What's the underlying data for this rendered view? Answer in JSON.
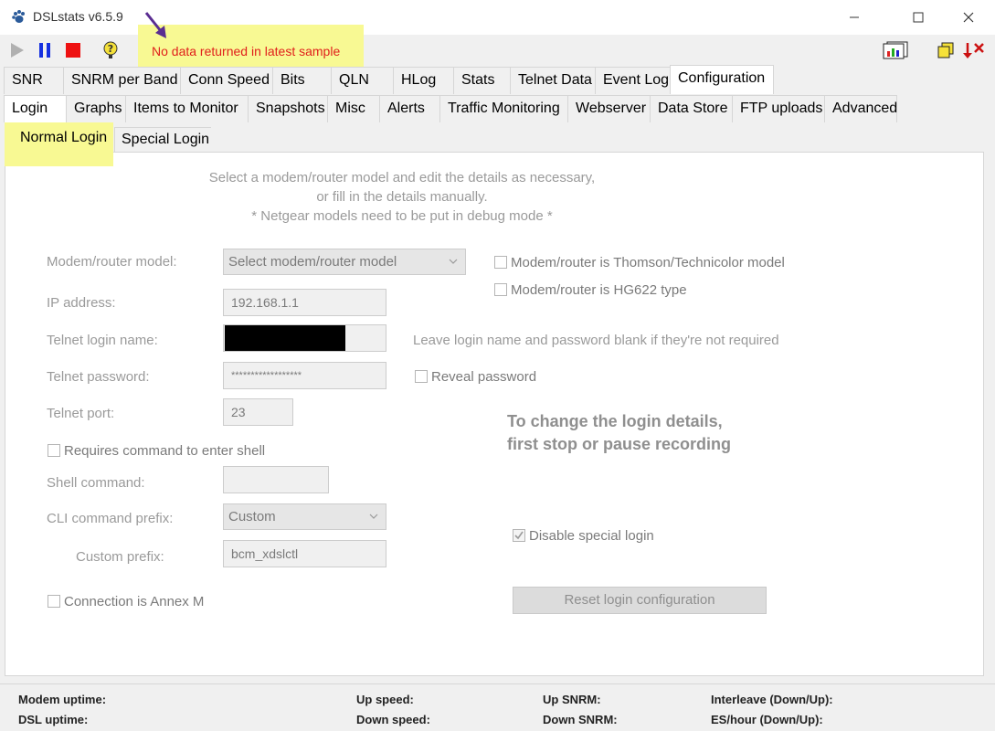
{
  "window": {
    "title": "DSLstats v6.5.9",
    "minimize_icon": "minimize-icon",
    "maximize_icon": "maximize-icon",
    "close_icon": "close-icon"
  },
  "toolbar": {
    "banner": "No data returned in latest sample",
    "banner_color": "#e0201c",
    "highlight_color": "#f8f993"
  },
  "tabs_main": [
    "SNR",
    "SNRM per Band",
    "Conn Speed",
    "Bits",
    "QLN",
    "HLog",
    "Stats",
    "Telnet Data",
    "Event Log",
    "Configuration"
  ],
  "tabs_config": [
    "Login",
    "Graphs",
    "Items to Monitor",
    "Snapshots",
    "Misc",
    "Alerts",
    "Traffic Monitoring",
    "Webserver",
    "Data Store",
    "FTP uploads",
    "Advanced"
  ],
  "tabs_login": [
    "Normal Login",
    "Special Login"
  ],
  "intro": {
    "line1": "Select a modem/router model and edit the details as necessary,",
    "line2": "or fill in the details manually.",
    "line3": "* Netgear models need to be put in debug mode *"
  },
  "form": {
    "model_label": "Modem/router model:",
    "model_value": "Select modem/router model",
    "ip_label": "IP address:",
    "ip_value": "192.168.1.1",
    "login_label": "Telnet login name:",
    "password_label": "Telnet password:",
    "password_value": "******************",
    "port_label": "Telnet port:",
    "port_value": "23",
    "requires_shell_label": "Requires command to enter shell",
    "shell_label": "Shell command:",
    "cli_label": "CLI command prefix:",
    "cli_value": "Custom",
    "custom_label": "Custom prefix:",
    "custom_value": "bcm_xdslctl",
    "annex_label": "Connection is Annex M",
    "thomson_label": "Modem/router is Thomson/Technicolor model",
    "hg622_label": "Modem/router is HG622 type",
    "blank_hint": "Leave login name and password blank if they're not required",
    "reveal_label": "Reveal password",
    "warn_line1": "To change the login details,",
    "warn_line2": "first stop or pause recording",
    "disable_special_label": "Disable special login",
    "reset_button": "Reset login configuration"
  },
  "status": {
    "modem_uptime": "Modem uptime:",
    "dsl_uptime": "DSL uptime:",
    "up_speed": "Up speed:",
    "down_speed": "Down speed:",
    "up_snrm": "Up SNRM:",
    "down_snrm": "Down SNRM:",
    "interleave": "Interleave (Down/Up):",
    "es_hour": "ES/hour (Down/Up):"
  }
}
